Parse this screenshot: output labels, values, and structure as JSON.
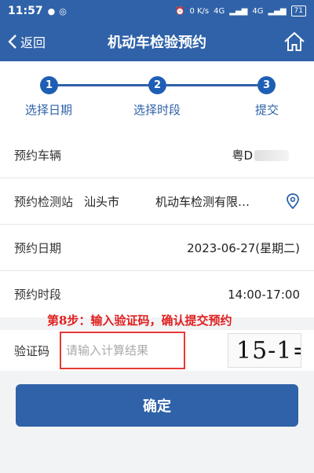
{
  "status_bar": {
    "time": "11:57",
    "battery": "71",
    "network_speed": "0 K/s",
    "signal_1": "4G",
    "signal_2": "4G"
  },
  "nav": {
    "back_label": "返回",
    "title": "机动车检验预约"
  },
  "steps": [
    {
      "number": "1",
      "label": "选择日期"
    },
    {
      "number": "2",
      "label": "选择时段"
    },
    {
      "number": "3",
      "label": "提交"
    }
  ],
  "form": {
    "vehicle": {
      "label": "预约车辆",
      "value": "粤D"
    },
    "station": {
      "label": "预约检测站",
      "city": "汕头市",
      "name": "机动车检测有限…"
    },
    "date": {
      "label": "预约日期",
      "value": "2023-06-27(星期二)"
    },
    "time_slot": {
      "label": "预约时段",
      "value": "14:00-17:00"
    }
  },
  "annotation": "第8步：输入验证码，确认提交预约",
  "captcha": {
    "label": "验证码",
    "placeholder": "请输入计算结果",
    "image_text": "15-1="
  },
  "confirm_label": "确定",
  "colors": {
    "primary": "#2f62a8",
    "step_circle": "#1e5fb5",
    "annotation": "#e02020",
    "input_border": "#e53935"
  }
}
